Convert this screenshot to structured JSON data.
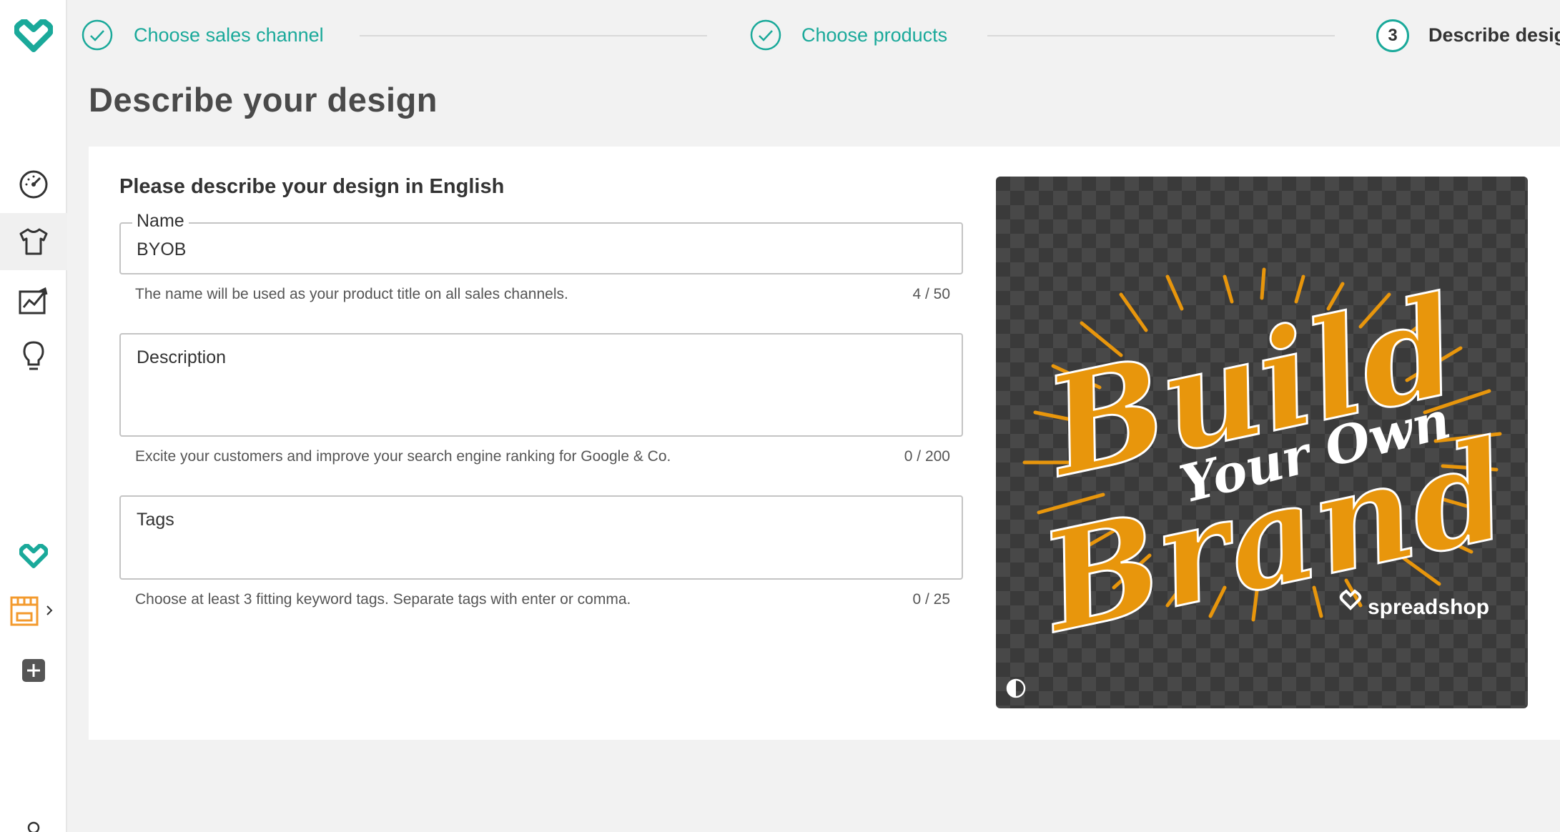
{
  "stepper": {
    "steps": [
      {
        "label": "Choose sales channel",
        "status": "done"
      },
      {
        "label": "Choose products",
        "status": "done"
      },
      {
        "number": "3",
        "label": "Describe design",
        "status": "current"
      }
    ],
    "accent_color": "#1aa99a"
  },
  "page": {
    "title": "Describe your design"
  },
  "form": {
    "heading": "Please describe your design in English",
    "name": {
      "label": "Name",
      "value": "BYOB",
      "helper": "The name will be used as your product title on all sales channels.",
      "counter": "4 / 50"
    },
    "description": {
      "label": "Description",
      "value": "",
      "helper": "Excite your customers and improve your search engine ranking for Google & Co.",
      "counter": "0 / 200"
    },
    "tags": {
      "label": "Tags",
      "value": "",
      "helper": "Choose at least 3 fitting keyword tags. Separate tags with enter or comma.",
      "counter": "0 / 25"
    }
  },
  "preview": {
    "art": {
      "line1": "Build",
      "line2": "Your Own",
      "line3": "Brand",
      "logo": "spreadshop"
    },
    "primary_color": "#e8960c"
  },
  "sidebar": {
    "icons": [
      "spreadshop-logo-icon",
      "dashboard-icon",
      "products-icon",
      "analytics-icon",
      "ideas-icon",
      "spreadshop-small-logo-icon",
      "shop-icon",
      "add-icon",
      "user-icon"
    ]
  }
}
